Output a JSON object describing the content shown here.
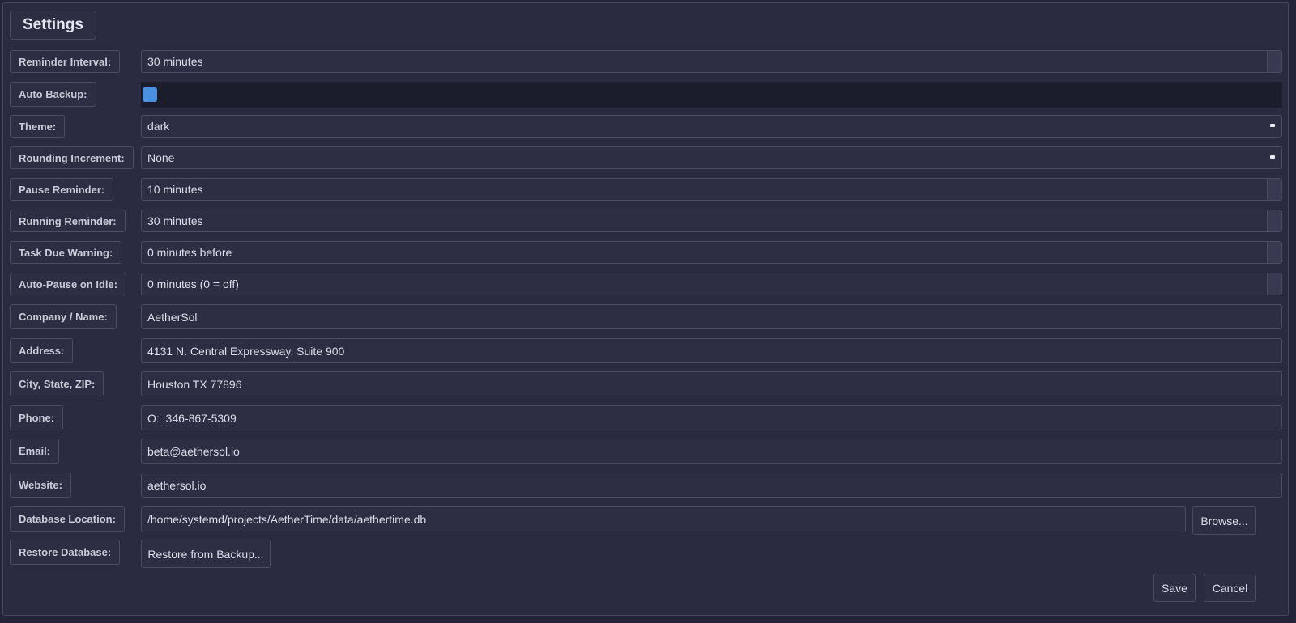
{
  "window": {
    "title": "Settings"
  },
  "settings": {
    "reminder_interval": {
      "label": "Reminder Interval:",
      "value": "30 minutes"
    },
    "auto_backup": {
      "label": "Auto Backup:",
      "checked": true
    },
    "theme": {
      "label": "Theme:",
      "value": "dark"
    },
    "rounding_increment": {
      "label": "Rounding Increment:",
      "value": "None"
    },
    "pause_reminder": {
      "label": "Pause Reminder:",
      "value": "10 minutes"
    },
    "running_reminder": {
      "label": "Running Reminder:",
      "value": "30 minutes"
    },
    "task_due_warning": {
      "label": "Task Due Warning:",
      "value": "0 minutes before"
    },
    "auto_pause_idle": {
      "label": "Auto-Pause on Idle:",
      "value": "0 minutes (0 = off)"
    },
    "company_name": {
      "label": "Company / Name:",
      "value": "AetherSol"
    },
    "address": {
      "label": "Address:",
      "value": "4131 N. Central Expressway, Suite 900"
    },
    "city_state_zip": {
      "label": "City, State, ZIP:",
      "value": "Houston TX 77896"
    },
    "phone": {
      "label": "Phone:",
      "value": "O:  346-867-5309"
    },
    "email": {
      "label": "Email:",
      "value": "beta@aethersol.io"
    },
    "website": {
      "label": "Website:",
      "value": "aethersol.io"
    },
    "database_location": {
      "label": "Database Location:",
      "value": "/home/systemd/projects/AetherTime/data/aethertime.db",
      "browse_label": "Browse..."
    },
    "restore_database": {
      "label": "Restore Database:",
      "button_label": "Restore from Backup..."
    }
  },
  "actions": {
    "save_label": "Save",
    "cancel_label": "Cancel"
  },
  "colors": {
    "accent": "#4a8fe0",
    "background": "#2a2b40",
    "field_background": "#2d2e44",
    "border": "#4a4c64"
  }
}
